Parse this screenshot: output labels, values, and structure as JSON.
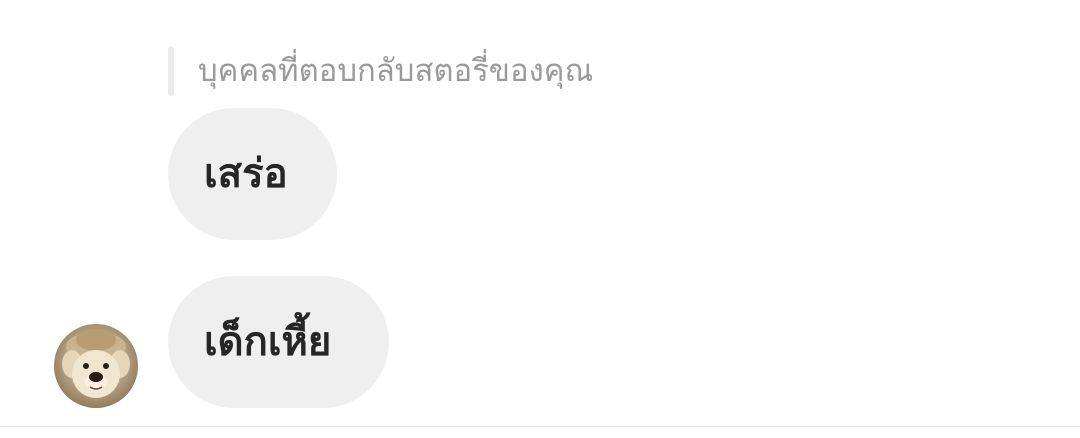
{
  "reply_context": {
    "text": "บุคคลที่ตอบกลับสตอรี่ของคุณ"
  },
  "messages": [
    {
      "text": "เสร่อ"
    },
    {
      "text": "เด็กเหี้ย"
    }
  ],
  "colors": {
    "bubble_bg": "#efefef",
    "reply_text": "#9a9a9a",
    "reply_bar": "#ebebeb",
    "message_text": "#262626"
  },
  "icons": {
    "avatar": "dog-avatar"
  }
}
